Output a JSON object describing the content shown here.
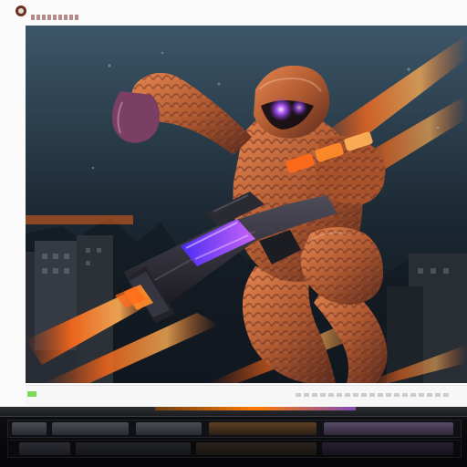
{
  "page": {
    "logo_mark": "",
    "top_tag": "",
    "art": {
      "alt": "",
      "subject": "",
      "accent_colors": {
        "orange": "#ff6a1a",
        "purple": "#7f42ff",
        "sky_dark": "#0b1016",
        "sky_mid": "#395163"
      }
    },
    "meta_strip": {
      "chip_color": "#7ed957"
    },
    "timeline": {
      "track_count": 2
    }
  }
}
